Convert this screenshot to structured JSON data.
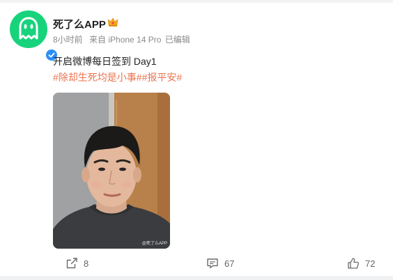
{
  "post": {
    "author": {
      "name": "死了么APP",
      "avatar_icon": "ghost-icon",
      "avatar_color": "#17d37c",
      "badge": "verified-icon",
      "crown_icon": "crown-icon"
    },
    "meta": {
      "time": "8小时前",
      "source": "来自 iPhone 14 Pro",
      "edited": "已编辑"
    },
    "text": "开启微博每日签到 Day1",
    "hashtags": "#除却生死均是小事##报平安#",
    "hashtag_color": "#eb7350",
    "photo": {
      "watermark": "@死了么APP"
    }
  },
  "actions": {
    "share_count": "8",
    "comment_count": "67",
    "like_count": "72"
  }
}
